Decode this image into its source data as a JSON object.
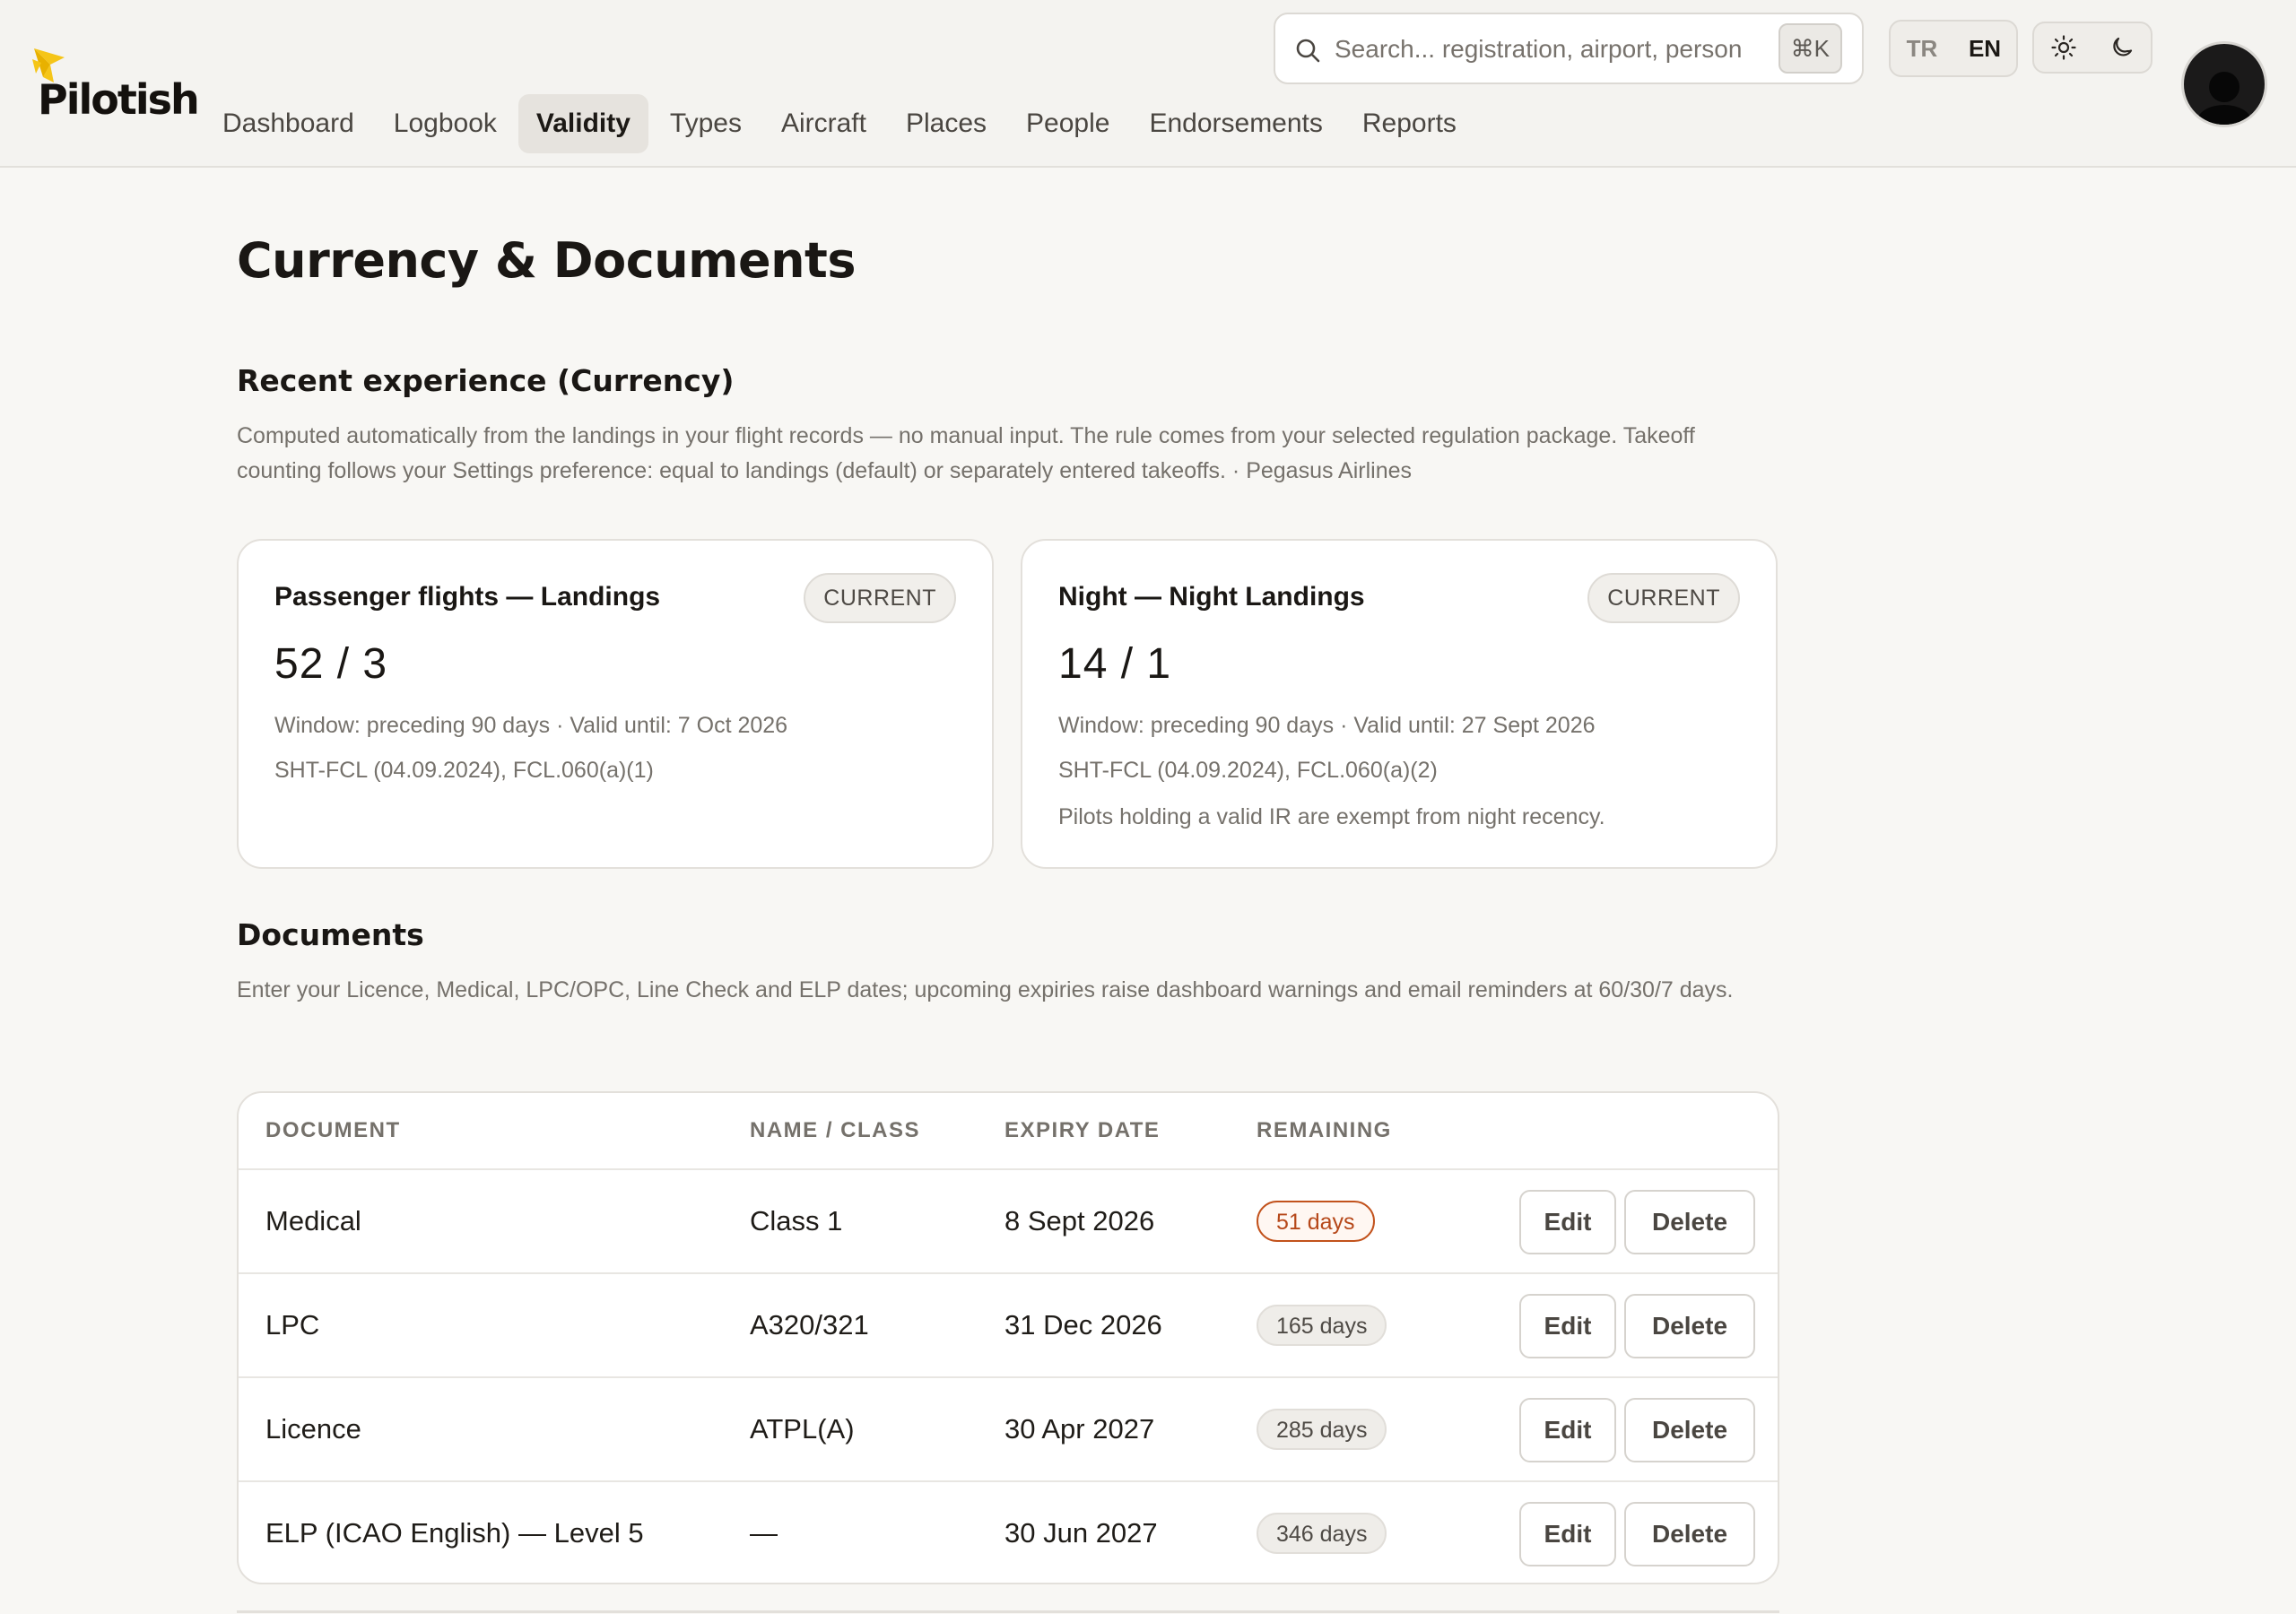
{
  "brand": {
    "name": "Pilotish",
    "accent": "#f5c518"
  },
  "nav": [
    {
      "label": "Dashboard"
    },
    {
      "label": "Logbook"
    },
    {
      "label": "Validity",
      "active": true
    },
    {
      "label": "Types"
    },
    {
      "label": "Aircraft"
    },
    {
      "label": "Places"
    },
    {
      "label": "People"
    },
    {
      "label": "Endorsements"
    },
    {
      "label": "Reports"
    }
  ],
  "search": {
    "placeholder": "Search... registration, airport, person",
    "shortcut": "⌘K",
    "icon": "search-icon"
  },
  "language": {
    "options": [
      "TR",
      "EN"
    ],
    "selected": "EN"
  },
  "theme": {
    "light_icon": "sun-icon",
    "dark_icon": "moon-icon"
  },
  "user": {
    "avatar_icon": "user-avatar"
  },
  "page": {
    "title": "Currency & Documents"
  },
  "currency": {
    "title": "Recent experience (Currency)",
    "description": "Computed automatically from the landings in your flight records — no manual input. The rule comes from your selected regulation package. Takeoff counting follows your Settings preference: equal to landings (default) or separately entered takeoffs. · Pegasus Airlines",
    "cards": [
      {
        "title": "Passenger flights — Landings",
        "status": "CURRENT",
        "value": "52 / 3",
        "window": "Window: preceding 90 days · Valid until: 7 Oct 2026",
        "rule": "SHT-FCL (04.09.2024), FCL.060(a)(1)",
        "note": ""
      },
      {
        "title": "Night — Night Landings",
        "status": "CURRENT",
        "value": "14 / 1",
        "window": "Window: preceding 90 days · Valid until: 27 Sept 2026",
        "rule": "SHT-FCL (04.09.2024), FCL.060(a)(2)",
        "note": "Pilots holding a valid IR are exempt from night recency."
      }
    ]
  },
  "documents": {
    "title": "Documents",
    "description": "Enter your Licence, Medical, LPC/OPC, Line Check and ELP dates; upcoming expiries raise dashboard warnings and email reminders at 60/30/7 days.",
    "columns": [
      "DOCUMENT",
      "NAME / CLASS",
      "EXPIRY DATE",
      "REMAINING"
    ],
    "edit_label": "Edit",
    "delete_label": "Delete",
    "rows": [
      {
        "document": "Medical",
        "name_class": "Class 1",
        "expiry": "8 Sept 2026",
        "remaining": "51 days",
        "warning": true
      },
      {
        "document": "LPC",
        "name_class": "A320/321",
        "expiry": "31 Dec 2026",
        "remaining": "165 days",
        "warning": false
      },
      {
        "document": "Licence",
        "name_class": "ATPL(A)",
        "expiry": "30 Apr 2027",
        "remaining": "285 days",
        "warning": false
      },
      {
        "document": "ELP (ICAO English) — Level 5",
        "name_class": "—",
        "expiry": "30 Jun 2027",
        "remaining": "346 days",
        "warning": false
      }
    ]
  }
}
